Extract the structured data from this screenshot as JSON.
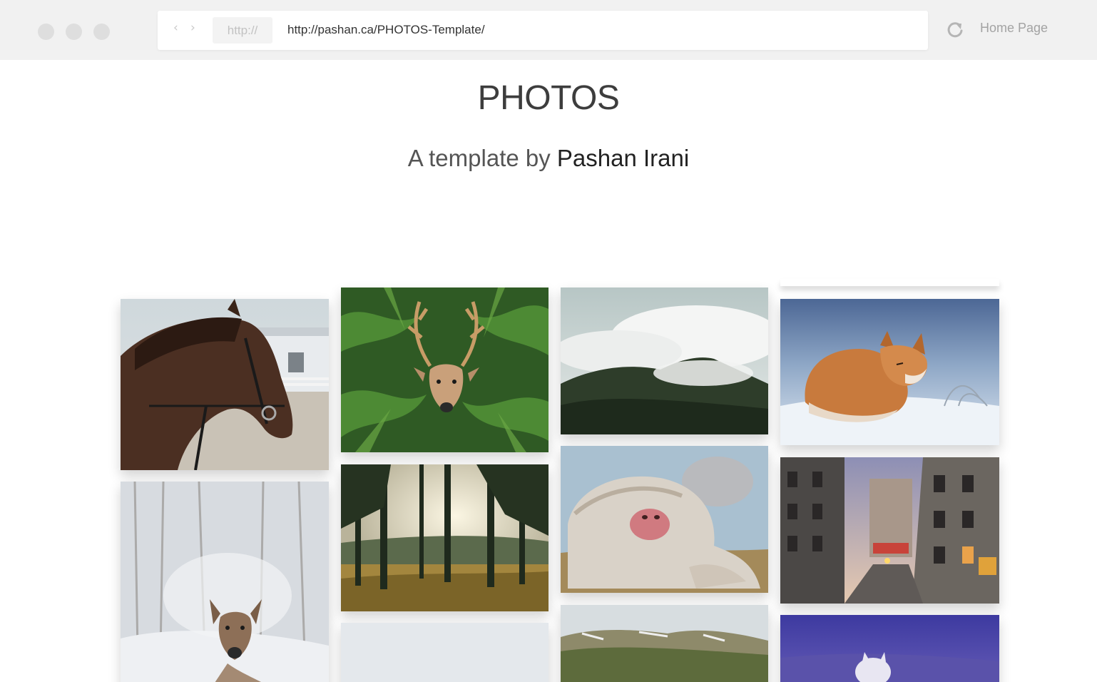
{
  "browser": {
    "protocol": "http://",
    "url": "http://pashan.ca/PHOTOS-Template/",
    "home_label": "Home Page",
    "icons": [
      "window-dot-icon",
      "back-arrow-icon",
      "forward-arrow-icon",
      "reload-icon"
    ]
  },
  "header": {
    "title": "PHOTOS",
    "subtitle_prefix": "A template by ",
    "author": "Pashan Irani"
  },
  "gallery": {
    "photos": [
      {
        "name": "horse"
      },
      {
        "name": "snowy-deer"
      },
      {
        "name": "deer-in-ferns"
      },
      {
        "name": "forest-sunlight"
      },
      {
        "name": "misty-sky"
      },
      {
        "name": "misty-mountain"
      },
      {
        "name": "snow-monkey"
      },
      {
        "name": "green-hills"
      },
      {
        "name": "top-edge-photo"
      },
      {
        "name": "red-fox-in-snow"
      },
      {
        "name": "paris-street"
      },
      {
        "name": "arctic-fox-purple"
      }
    ]
  }
}
